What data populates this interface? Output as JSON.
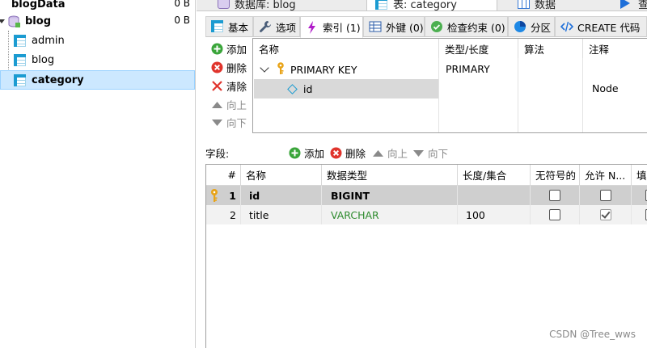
{
  "tree": {
    "items": [
      {
        "label": "blogData",
        "size": "0 B"
      },
      {
        "label": "blog",
        "size": "0 B"
      },
      {
        "label": "admin"
      },
      {
        "label": "blog"
      },
      {
        "label": "category"
      }
    ]
  },
  "top_tabs": [
    {
      "label": "数据库: blog"
    },
    {
      "label": "表: category"
    },
    {
      "label": "数据"
    },
    {
      "label": "查"
    }
  ],
  "sub_tabs": [
    {
      "label": "基本"
    },
    {
      "label": "选项"
    },
    {
      "label": "索引 (1)"
    },
    {
      "label": "外键 (0)"
    },
    {
      "label": "检查约束 (0)"
    },
    {
      "label": "分区"
    },
    {
      "label": "CREATE 代码"
    }
  ],
  "index_toolbar": {
    "add": "添加",
    "delete": "删除",
    "clear": "清除",
    "up": "向上",
    "down": "向下"
  },
  "index_grid": {
    "headers": [
      "名称",
      "类型/长度",
      "算法",
      "注释"
    ],
    "key_name": "PRIMARY KEY",
    "key_type": "PRIMARY",
    "column": "id",
    "comment": "Node"
  },
  "fields_toolbar": {
    "label": "字段:",
    "add": "添加",
    "delete": "删除",
    "up": "向上",
    "down": "向下"
  },
  "field_grid": {
    "headers": [
      "#",
      "名称",
      "数据类型",
      "长度/集合",
      "无符号的",
      "允许 N...",
      "填"
    ],
    "rows": [
      {
        "num": "1",
        "name": "id",
        "type": "BIGINT",
        "length": "",
        "unsigned": false,
        "nullable": false
      },
      {
        "num": "2",
        "name": "title",
        "type": "VARCHAR",
        "length": "100",
        "unsigned": false,
        "nullable": true
      }
    ]
  },
  "colors": {
    "varchar_type": "#2e8b2e",
    "selection": "#cce8ff",
    "table_icon": "#1b9bd1",
    "key_icon": "#e8a317"
  },
  "watermark": "CSDN @Tree_wws"
}
